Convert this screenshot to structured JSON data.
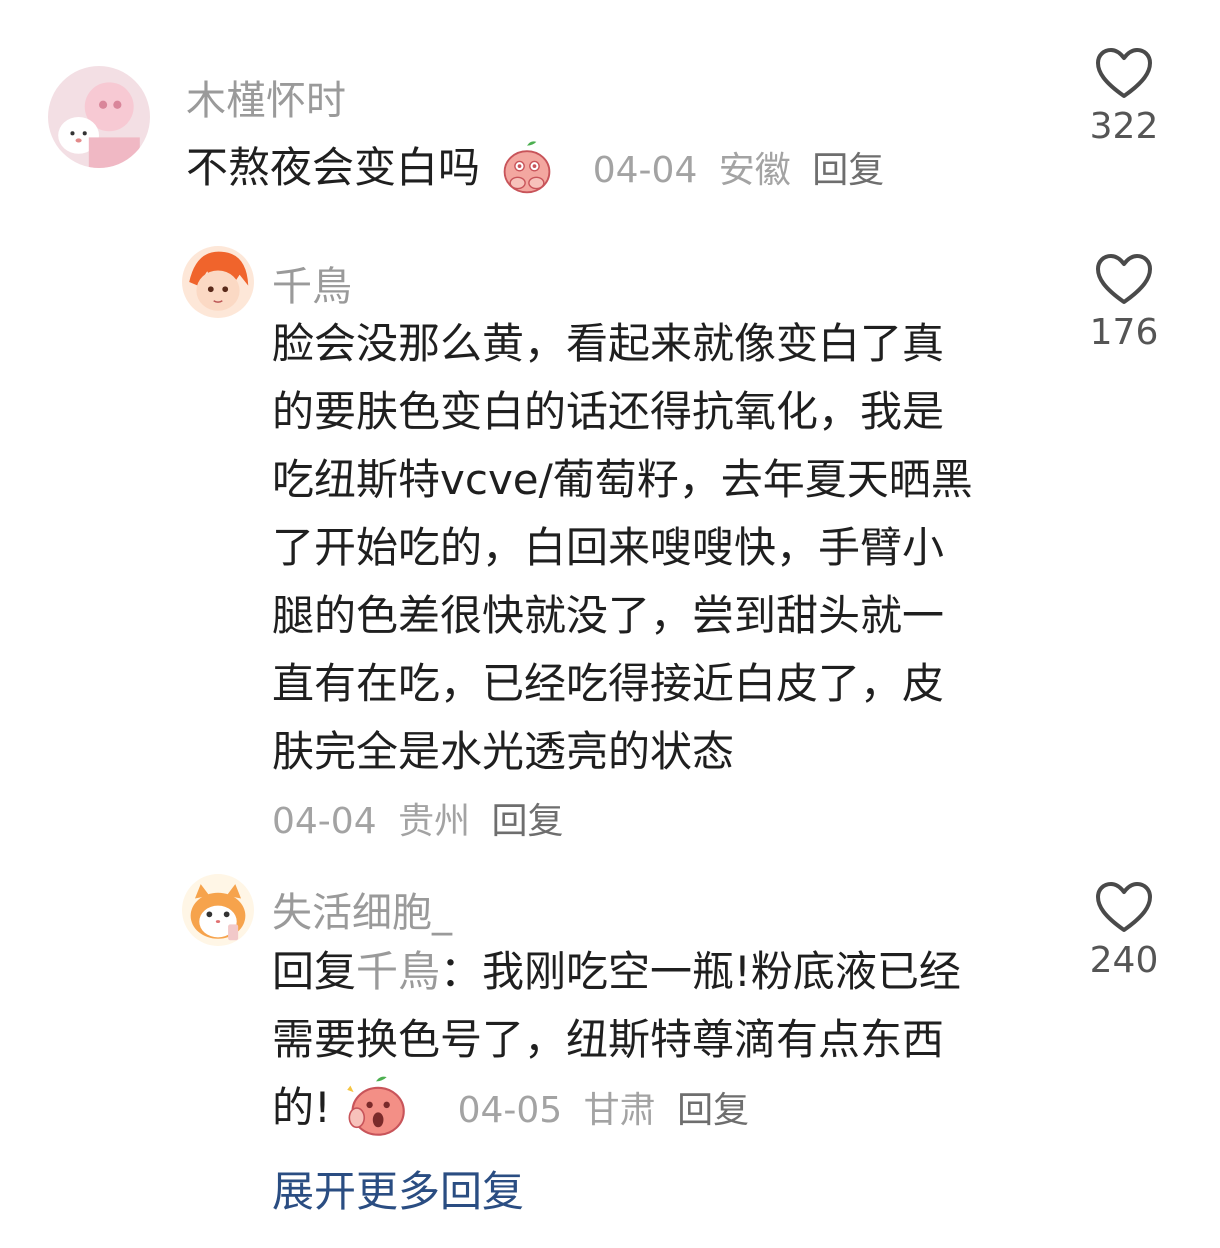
{
  "comments": [
    {
      "username": "木槿怀时",
      "text": "不熬夜会变白吗",
      "emoji": "peach-hands-face-emoji",
      "date": "04-04",
      "location": "安徽",
      "reply_label": "回复",
      "likes": "322"
    },
    {
      "username": "千鳥",
      "lines": [
        "脸会没那么黄，看起来就像变白了真",
        "的要肤色变白的话还得抗氧化，我是",
        "吃纽斯特vcve/葡萄籽，去年夏天晒黑",
        "了开始吃的，白回来嗖嗖快，手臂小",
        "腿的色差很快就没了，尝到甜头就一",
        "直有在吃，已经吃得接近白皮了，皮",
        "肤完全是水光透亮的状态"
      ],
      "date": "04-04",
      "location": "贵州",
      "reply_label": "回复",
      "likes": "176"
    },
    {
      "username": "失活细胞_",
      "reply_prefix": "回复",
      "mention": "千鳥",
      "colon": "：",
      "line1_rest": "我刚吃空一瓶!粉底液已经",
      "line2": "需要换色号了，纽斯特尊滴有点东西",
      "line3": "的!",
      "emoji": "peach-shocked-face-emoji",
      "date": "04-05",
      "location": "甘肃",
      "reply_label": "回复",
      "likes": "240"
    }
  ],
  "expand_label": "展开更多回复"
}
